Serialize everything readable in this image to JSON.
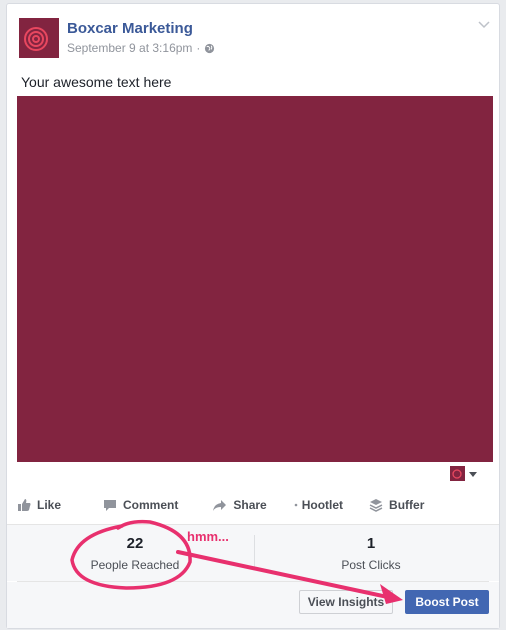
{
  "post": {
    "page_name": "Boxcar Marketing",
    "timestamp": "September 9 at 3:16pm",
    "separator": "·",
    "text": "Your awesome text here",
    "image_color": "#822440"
  },
  "actions": {
    "like": "Like",
    "comment": "Comment",
    "share": "Share",
    "hootlet": "Hootlet",
    "buffer": "Buffer"
  },
  "stats": {
    "reached_count": "22",
    "reached_label": "People Reached",
    "clicks_count": "1",
    "clicks_label": "Post Clicks"
  },
  "buttons": {
    "view_insights": "View Insights",
    "boost_post": "Boost Post"
  },
  "annotation": {
    "text": "hmm...",
    "color": "#e8306e"
  },
  "colors": {
    "brand_link": "#3b5998",
    "boost_button": "#4267b2"
  }
}
